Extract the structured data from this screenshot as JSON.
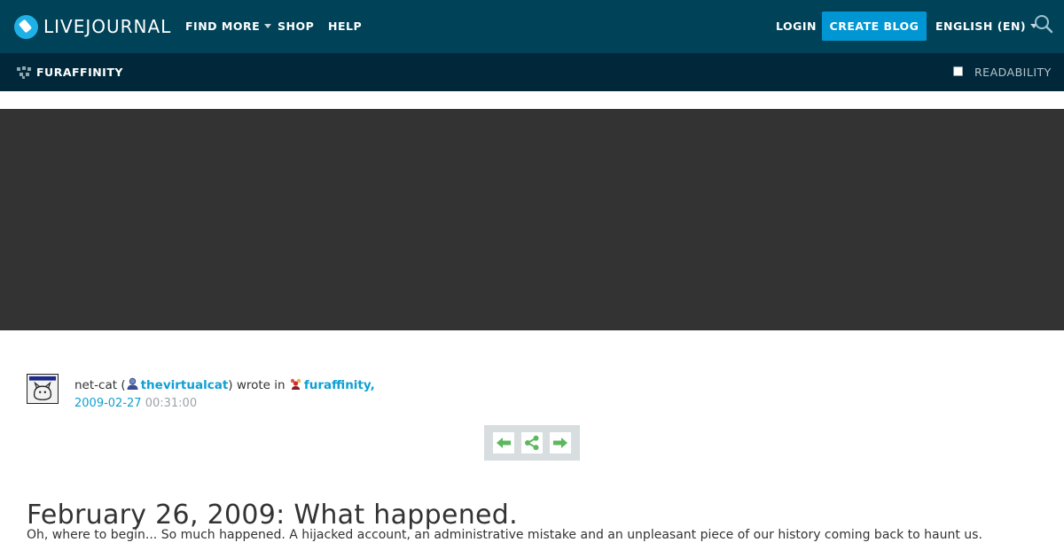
{
  "header": {
    "logo_text": "LIVEJOURNAL",
    "nav": [
      {
        "label": "FIND MORE",
        "has_caret": true
      },
      {
        "label": "SHOP",
        "has_caret": false
      },
      {
        "label": "HELP",
        "has_caret": false
      }
    ],
    "login_label": "LOGIN",
    "create_label": "CREATE BLOG",
    "language_label": "ENGLISH (EN)",
    "icons": {
      "search": "search-icon"
    }
  },
  "subheader": {
    "community_name": "FURAFFINITY",
    "readability_label": "READABILITY",
    "readability_checked": false
  },
  "entry": {
    "author_name": "net-cat",
    "open_paren": "(",
    "username": "thevirtualcat",
    "wrote_in": ") wrote in",
    "community": "furaffinity",
    "comma": ",",
    "date": "2009-02-27",
    "time": "00:31:00",
    "title": "February 26, 2009: What happened.",
    "body_first_line": "Oh, where to begin... So much happened. A hijacked account, an administrative mistake and an unpleasant piece of our history coming back to haunt us."
  },
  "colors": {
    "topbar": "#004359",
    "subbar": "#00283a",
    "accent": "#0096d3",
    "link": "#0e9fd3",
    "banner": "#333333",
    "nav_arrow": "#5cb85c"
  }
}
